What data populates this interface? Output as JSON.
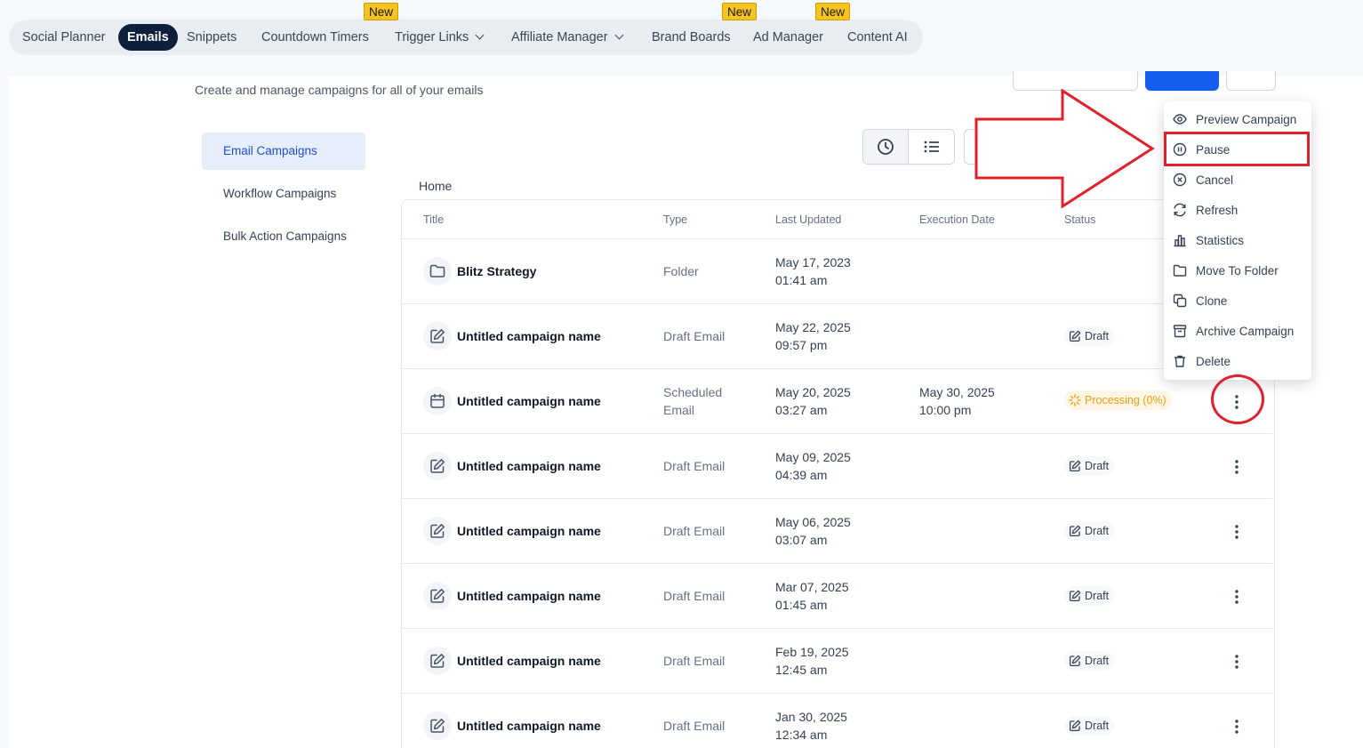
{
  "nav": {
    "items": [
      {
        "label": "Social Planner",
        "badge": ""
      },
      {
        "label": "Emails",
        "badge": ""
      },
      {
        "label": "Snippets",
        "badge": ""
      },
      {
        "label": "Countdown Timers",
        "badge": "New"
      },
      {
        "label": "Trigger Links",
        "badge": ""
      },
      {
        "label": "Affiliate Manager",
        "badge": ""
      },
      {
        "label": "Brand Boards",
        "badge": "New"
      },
      {
        "label": "Ad Manager",
        "badge": ""
      },
      {
        "label": "Content AI",
        "badge": "New"
      }
    ]
  },
  "header": {
    "subtitle": "Create and manage campaigns for all of your emails"
  },
  "sidebar": {
    "items": [
      {
        "label": "Email Campaigns"
      },
      {
        "label": "Workflow Campaigns"
      },
      {
        "label": "Bulk Action Campaigns"
      }
    ]
  },
  "breadcrumb": "Home",
  "table": {
    "columns": [
      "Title",
      "Type",
      "Last Updated",
      "Execution Date",
      "Status"
    ],
    "rows": [
      {
        "icon": "folder-icon",
        "title": "Blitz Strategy",
        "type_line1": "Folder",
        "type_line2": "",
        "date": "May 17, 2023",
        "time": "01:41 am",
        "exec_date": "",
        "exec_time": "",
        "status": ""
      },
      {
        "icon": "edit-icon",
        "title": "Untitled campaign name",
        "type_line1": "Draft Email",
        "type_line2": "",
        "date": "May 22, 2025",
        "time": "09:57 pm",
        "exec_date": "",
        "exec_time": "",
        "status": "Draft"
      },
      {
        "icon": "calendar-icon",
        "title": "Untitled campaign name",
        "type_line1": "Scheduled",
        "type_line2": "Email",
        "date": "May 20, 2025",
        "time": "03:27 am",
        "exec_date": "May 30, 2025",
        "exec_time": "10:00 pm",
        "status": "Processing (0%)"
      },
      {
        "icon": "edit-icon",
        "title": "Untitled campaign name",
        "type_line1": "Draft Email",
        "type_line2": "",
        "date": "May 09, 2025",
        "time": "04:39 am",
        "exec_date": "",
        "exec_time": "",
        "status": "Draft"
      },
      {
        "icon": "edit-icon",
        "title": "Untitled campaign name",
        "type_line1": "Draft Email",
        "type_line2": "",
        "date": "May 06, 2025",
        "time": "03:07 am",
        "exec_date": "",
        "exec_time": "",
        "status": "Draft"
      },
      {
        "icon": "edit-icon",
        "title": "Untitled campaign name",
        "type_line1": "Draft Email",
        "type_line2": "",
        "date": "Mar 07, 2025",
        "time": "01:45 am",
        "exec_date": "",
        "exec_time": "",
        "status": "Draft"
      },
      {
        "icon": "edit-icon",
        "title": "Untitled campaign name",
        "type_line1": "Draft Email",
        "type_line2": "",
        "date": "Feb 19, 2025",
        "time": "12:45 am",
        "exec_date": "",
        "exec_time": "",
        "status": "Draft"
      },
      {
        "icon": "edit-icon",
        "title": "Untitled campaign name",
        "type_line1": "Draft Email",
        "type_line2": "",
        "date": "Jan 30, 2025",
        "time": "12:34 am",
        "exec_date": "",
        "exec_time": "",
        "status": "Draft"
      }
    ]
  },
  "menu": {
    "items": [
      {
        "label": "Preview Campaign",
        "icon": "eye-icon"
      },
      {
        "label": "Pause",
        "icon": "pause-icon"
      },
      {
        "label": "Cancel",
        "icon": "cancel-icon"
      },
      {
        "label": "Refresh",
        "icon": "refresh-icon"
      },
      {
        "label": "Statistics",
        "icon": "statistics-icon"
      },
      {
        "label": "Move To Folder",
        "icon": "folder-icon"
      },
      {
        "label": "Clone",
        "icon": "clone-icon"
      },
      {
        "label": "Archive Campaign",
        "icon": "archive-icon"
      },
      {
        "label": "Delete",
        "icon": "trash-icon"
      }
    ]
  },
  "colors": {
    "active_nav": "#0d1f3c",
    "primary": "#155eef",
    "new_badge": "#f7c320",
    "annotation": "#e0202a",
    "processing": "#f59e0b"
  }
}
